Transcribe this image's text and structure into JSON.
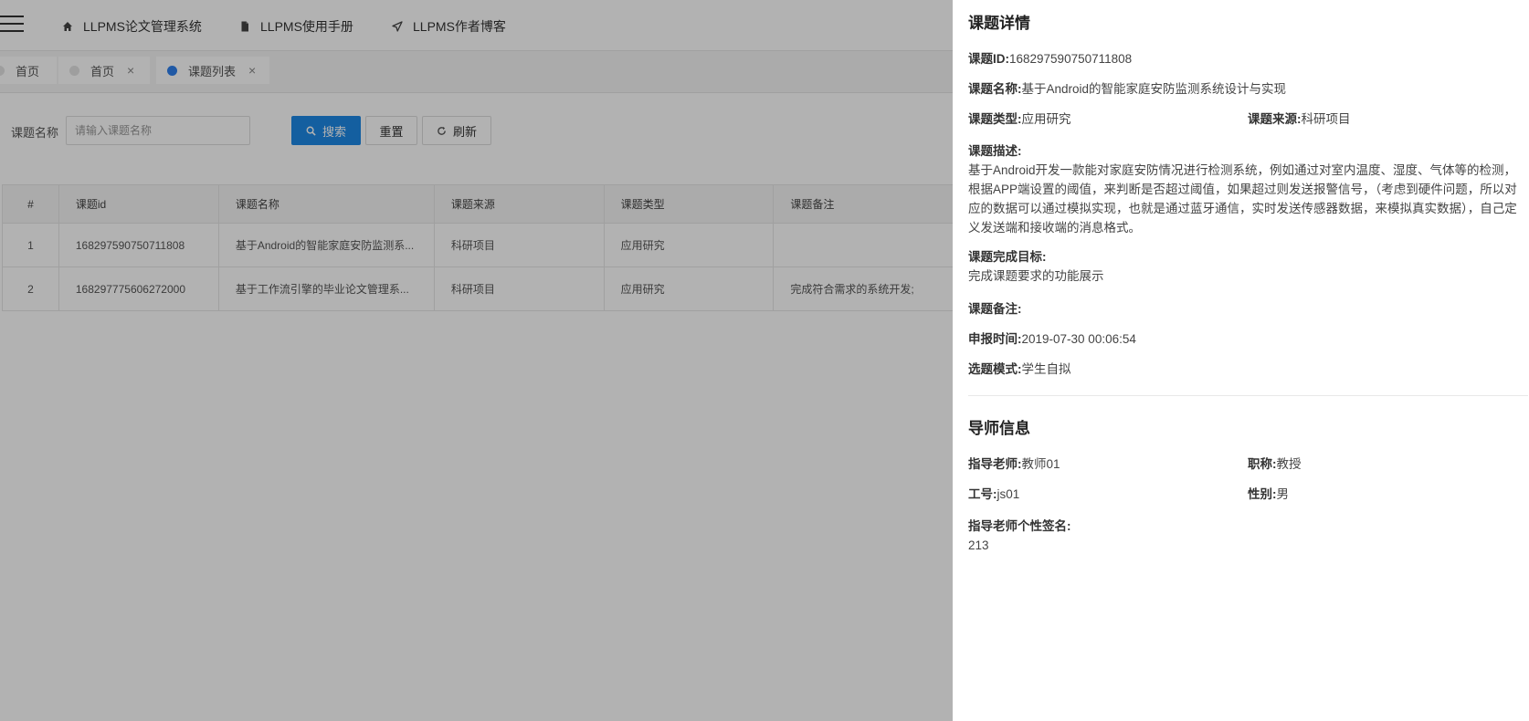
{
  "topnav": {
    "items": [
      {
        "label": "LLPMS论文管理系统",
        "icon": "home-icon"
      },
      {
        "label": "LLPMS使用手册",
        "icon": "document-icon"
      },
      {
        "label": "LLPMS作者博客",
        "icon": "send-icon"
      }
    ]
  },
  "tabs": [
    {
      "label": "首页",
      "closable": false
    },
    {
      "label": "首页",
      "closable": true
    },
    {
      "label": "课题列表",
      "closable": true,
      "active": true
    }
  ],
  "search": {
    "label": "课题名称",
    "placeholder": "请输入课题名称",
    "search_label": "搜索",
    "reset_label": "重置",
    "refresh_label": "刷新"
  },
  "table": {
    "headers": [
      "#",
      "课题id",
      "课题名称",
      "课题来源",
      "课题类型",
      "课题备注"
    ],
    "rows": [
      [
        "1",
        "168297590750711808",
        "基于Android的智能家庭安防监测系...",
        "科研项目",
        "应用研究",
        ""
      ],
      [
        "2",
        "168297775606272000",
        "基于工作流引擎的毕业论文管理系...",
        "科研项目",
        "应用研究",
        "完成符合需求的系统开发;"
      ]
    ]
  },
  "detail": {
    "title": "课题详情",
    "id_label": "课题ID:",
    "id_value": "168297590750711808",
    "name_label": "课题名称:",
    "name_value": "基于Android的智能家庭安防监测系统设计与实现",
    "type_label": "课题类型:",
    "type_value": "应用研究",
    "source_label": "课题来源:",
    "source_value": "科研项目",
    "desc_label": "课题描述:",
    "desc_value": "基于Android开发一款能对家庭安防情况进行检测系统，例如通过对室内温度、湿度、气体等的检测，根据APP端设置的阈值，来判断是否超过阈值，如果超过则发送报警信号，（考虑到硬件问题，所以对应的数据可以通过模拟实现，也就是通过蓝牙通信，实时发送传感器数据，来模拟真实数据），自己定义发送端和接收端的消息格式。",
    "goal_label": "课题完成目标:",
    "goal_value": "完成课题要求的功能展示",
    "remark_label": "课题备注:",
    "remark_value": "",
    "time_label": "申报时间:",
    "time_value": "2019-07-30 00:06:54",
    "mode_label": "选题模式:",
    "mode_value": "学生自拟"
  },
  "tutor": {
    "title": "导师信息",
    "teacher_label": "指导老师:",
    "teacher_value": "教师01",
    "rank_label": "职称:",
    "rank_value": "教授",
    "no_label": "工号:",
    "no_value": "js01",
    "gender_label": "性别:",
    "gender_value": "男",
    "sign_label": "指导老师个性签名:",
    "sign_value": "213"
  }
}
